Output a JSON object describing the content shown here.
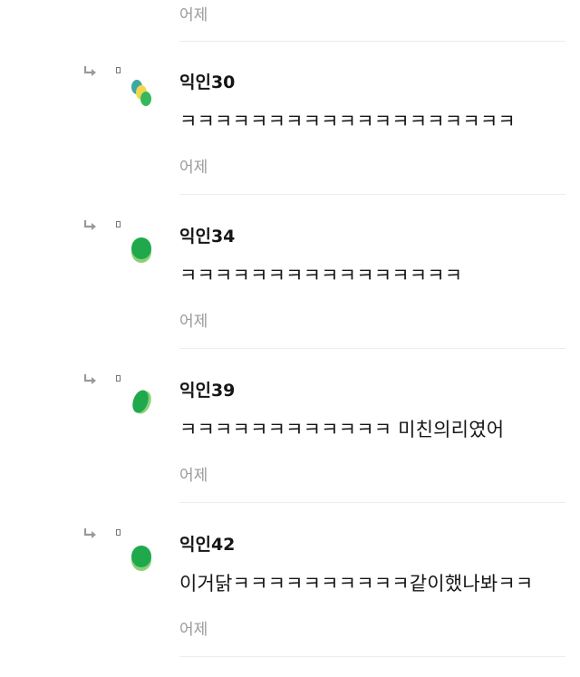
{
  "top": {
    "time": "어제"
  },
  "comments": [
    {
      "name": "익인30",
      "text": "ㅋㅋㅋㅋㅋㅋㅋㅋㅋㅋㅋㅋㅋㅋㅋㅋㅋㅋㅋ",
      "time": "어제",
      "avatar_colors": [
        "#3ea7a3",
        "#f2d64b",
        "#34b85a"
      ]
    },
    {
      "name": "익인34",
      "text": "ㅋㅋㅋㅋㅋㅋㅋㅋㅋㅋㅋㅋㅋㅋㅋㅋ",
      "time": "어제",
      "avatar_colors": [
        "#1fa84c",
        "#8bd17a"
      ]
    },
    {
      "name": "익인39",
      "text": "ㅋㅋㅋㅋㅋㅋㅋㅋㅋㅋㅋㅋ 미친의리였어",
      "time": "어제",
      "avatar_colors": [
        "#1fa84c",
        "#8bd17a"
      ]
    },
    {
      "name": "익인42",
      "text": "이거닭ㅋㅋㅋㅋㅋㅋㅋㅋㅋㅋ같이했나봐ㅋㅋ",
      "time": "어제",
      "avatar_colors": [
        "#1fa84c",
        "#8bd17a"
      ]
    }
  ]
}
